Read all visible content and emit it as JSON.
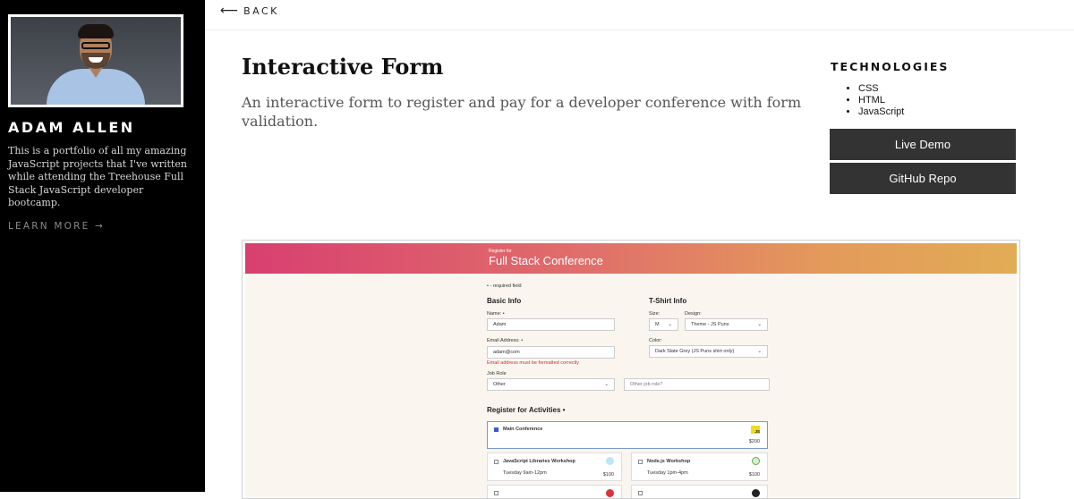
{
  "sidebar": {
    "name": "ADAM ALLEN",
    "bio": "This is a portfolio of all my amazing JavaScript projects that I've written while attending the Treehouse Full Stack JavaScript developer bootcamp.",
    "learn_more": "LEARN MORE →"
  },
  "nav": {
    "back_label": "BACK",
    "back_arrow": "⟵"
  },
  "project": {
    "title": "Interactive Form",
    "description": "An interactive form to register and pay for a developer conference with form validation.",
    "technologies_heading": "TECHNOLOGIES",
    "technologies": [
      "CSS",
      "HTML",
      "JavaScript"
    ],
    "live_demo": "Live Demo",
    "github_repo": "GitHub Repo"
  },
  "preview": {
    "header_sub": "Register for",
    "header_title": "Full Stack Conference",
    "required_note": "• - required field",
    "basic_info": "Basic Info",
    "name_label": "Name: •",
    "name_value": "Adam",
    "email_label": "Email Address: •",
    "email_value": "adam@com",
    "email_error": "Email address must be formatted correctly",
    "job_role_label": "Job Role",
    "job_role_value": "Other",
    "other_job_placeholder": "Other job role?",
    "tshirt_info": "T-Shirt Info",
    "size_label": "Size:",
    "size_value": "M",
    "design_label": "Design:",
    "design_value": "Theme - JS Puns",
    "color_label": "Color:",
    "color_value": "Dark Slate Grey (JS Puns shirt only)",
    "activities_heading": "Register for Activities •",
    "main_conf": "Main Conference",
    "main_conf_price": "$200",
    "js_libs": "JavaScript Libraries Workshop",
    "js_libs_time": "Tuesday 9am-12pm",
    "js_libs_price": "$100",
    "node": "Node.js Workshop",
    "node_time": "Tuesday 1pm-4pm",
    "node_price": "$100",
    "js_badge": "JS"
  },
  "colors": {
    "sidebar_bg": "#000000",
    "button_bg": "#333333",
    "error": "#d03030"
  }
}
